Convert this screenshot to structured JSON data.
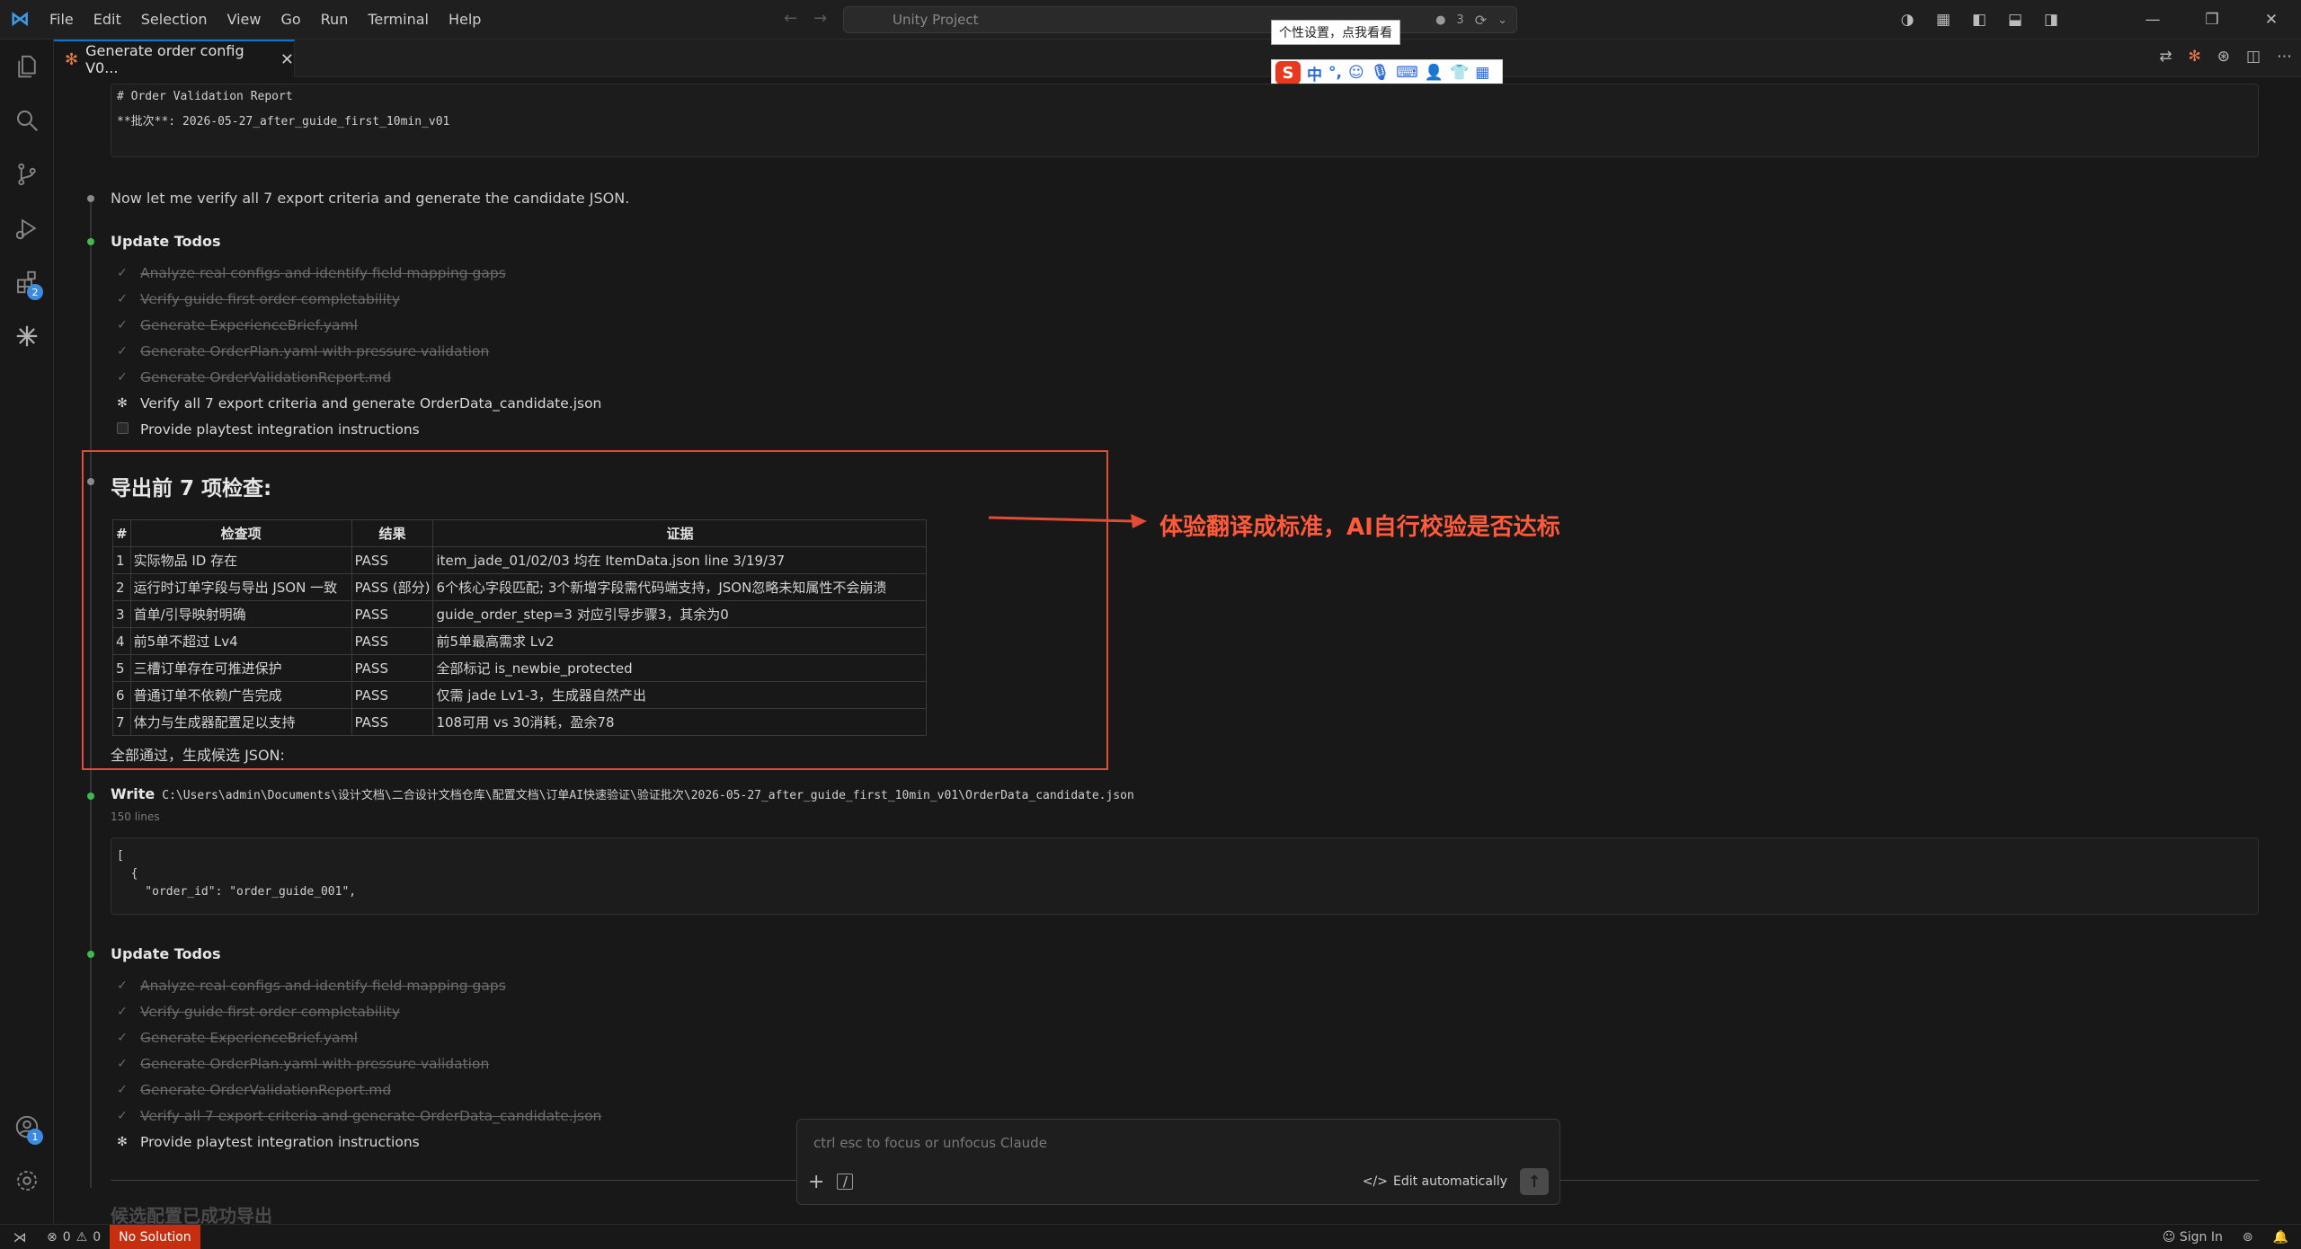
{
  "window": {
    "menu": [
      "File",
      "Edit",
      "Selection",
      "View",
      "Go",
      "Run",
      "Terminal",
      "Help"
    ],
    "search_placeholder": "Unity Project",
    "agents_count": "3"
  },
  "tab": {
    "title": "Generate order config V0..."
  },
  "ime": {
    "tooltip": "个性设置，点我看看",
    "zh_label": "中",
    "punct_label": "°,"
  },
  "code_top": {
    "line1": "# Order Validation Report",
    "line2": "**批次**: 2026-05-27_after_guide_first_10min_v01"
  },
  "verify_message": "Now let me verify all 7 export criteria and generate the candidate JSON.",
  "todos1": {
    "title": "Update Todos",
    "items": [
      {
        "text": "Analyze real configs and identify field mapping gaps",
        "mark": "✓"
      },
      {
        "text": "Verify guide first order completability",
        "mark": "✓"
      },
      {
        "text": "Generate ExperienceBrief.yaml",
        "mark": "✓"
      },
      {
        "text": "Generate OrderPlan.yaml with pressure validation",
        "mark": "✓"
      },
      {
        "text": "Generate OrderValidationReport.md",
        "mark": "✓"
      },
      {
        "text": "Verify all 7 export criteria and generate OrderData_candidate.json",
        "mark": "✻"
      },
      {
        "text": "Provide playtest integration instructions",
        "mark": ""
      }
    ]
  },
  "checks": {
    "title": "导出前 7 项检查:",
    "headers": [
      "#",
      "检查项",
      "结果",
      "证据"
    ],
    "rows": [
      [
        "1",
        "实际物品 ID 存在",
        "PASS",
        "item_jade_01/02/03 均在 ItemData.json line 3/19/37"
      ],
      [
        "2",
        "运行时订单字段与导出 JSON 一致",
        "PASS (部分)",
        "6个核心字段匹配; 3个新增字段需代码端支持，JSON忽略未知属性不会崩溃"
      ],
      [
        "3",
        "首单/引导映射明确",
        "PASS",
        "guide_order_step=3 对应引导步骤3，其余为0"
      ],
      [
        "4",
        "前5单不超过 Lv4",
        "PASS",
        "前5单最高需求 Lv2"
      ],
      [
        "5",
        "三槽订单存在可推进保护",
        "PASS",
        "全部标记 is_newbie_protected"
      ],
      [
        "6",
        "普通订单不依赖广告完成",
        "PASS",
        "仅需 jade Lv1-3，生成器自然产出"
      ],
      [
        "7",
        "体力与生成器配置足以支持",
        "PASS",
        "108可用 vs 30消耗，盈余78"
      ]
    ],
    "summary": "全部通过，生成候选 JSON:"
  },
  "annotation": "体验翻译成标准，AI自行校验是否达标",
  "write": {
    "label": "Write",
    "path": "C:\\Users\\admin\\Documents\\设计文档\\二合设计文档仓库\\配置文档\\订单AI快速验证\\验证批次\\2026-05-27_after_guide_first_10min_v01\\OrderData_candidate.json",
    "lines": "150 lines",
    "code1": "[",
    "code2": "  {",
    "code3": "    \"order_id\": \"order_guide_001\","
  },
  "todos2": {
    "title": "Update Todos",
    "items": [
      {
        "text": "Analyze real configs and identify field mapping gaps",
        "mark": "✓"
      },
      {
        "text": "Verify guide first order completability",
        "mark": "✓"
      },
      {
        "text": "Generate ExperienceBrief.yaml",
        "mark": "✓"
      },
      {
        "text": "Generate OrderPlan.yaml with pressure validation",
        "mark": "✓"
      },
      {
        "text": "Generate OrderValidationReport.md",
        "mark": "✓"
      },
      {
        "text": "Verify all 7 export criteria and generate OrderData_candidate.json",
        "mark": "✓"
      },
      {
        "text": "Provide playtest integration instructions",
        "mark": "✻"
      }
    ]
  },
  "faded_heading": "候选配置已成功导出",
  "claude": {
    "placeholder": "ctrl esc to focus or unfocus Claude",
    "edit_mode": "Edit automatically"
  },
  "status": {
    "errors": "0",
    "warnings": "0",
    "no_solution": "No Solution",
    "sign_in": "Sign In"
  },
  "colors": {
    "accent": "#0078d4",
    "annotation": "#ff5a3a",
    "status_red": "#c72e0f",
    "done_green": "#3fb950"
  }
}
